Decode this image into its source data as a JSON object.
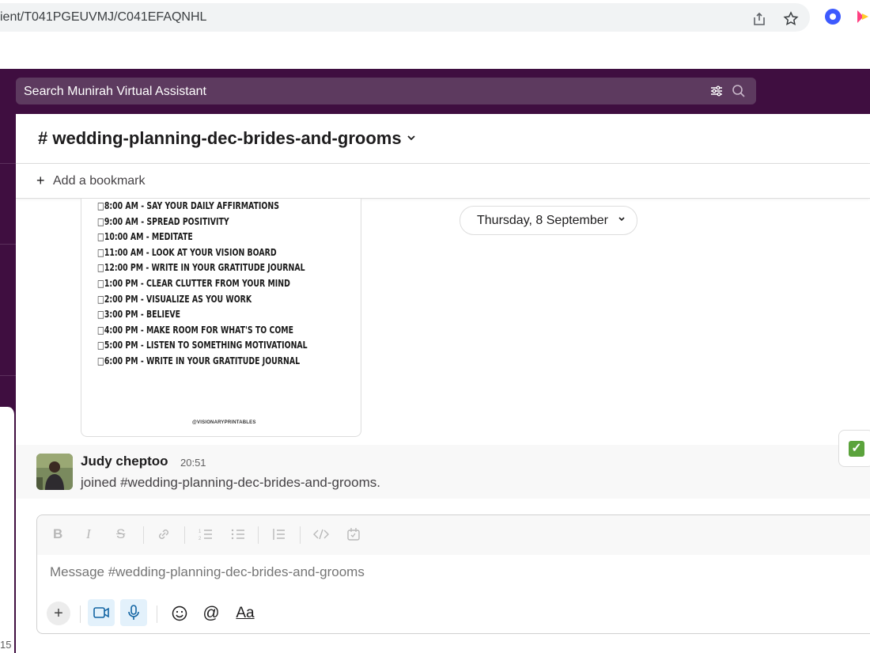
{
  "browser": {
    "url": "ient/T041PGEUVMJ/C041EFAQNHL"
  },
  "topbar": {
    "search_placeholder": "Search Munirah Virtual Assistant"
  },
  "sidebar": {
    "bottom_number": "15"
  },
  "channel": {
    "name": "# wedding-planning-dec-brides-and-grooms",
    "bookmark_label": "Add a bookmark"
  },
  "image_card": {
    "schedule": [
      "8:00 AM - SAY YOUR DAILY AFFIRMATIONS",
      "9:00 AM - SPREAD POSITIVITY",
      "10:00 AM - MEDITATE",
      "11:00 AM - LOOK AT YOUR VISION BOARD",
      "12:00 PM - WRITE IN YOUR GRATITUDE JOURNAL",
      "1:00 PM - CLEAR CLUTTER FROM YOUR MIND",
      "2:00 PM - VISUALIZE AS YOU WORK",
      "3:00 PM - BELIEVE",
      "4:00 PM - MAKE ROOM FOR WHAT'S TO COME",
      "5:00 PM - LISTEN TO SOMETHING MOTIVATIONAL",
      "6:00 PM - WRITE IN YOUR GRATITUDE JOURNAL"
    ],
    "watermark": "@VISIONARYPRINTABLES"
  },
  "date_divider": {
    "label": "Thursday, 8 September"
  },
  "message": {
    "author": "Judy cheptoo",
    "time": "20:51",
    "text": "joined #wedding-planning-dec-brides-and-grooms."
  },
  "composer": {
    "placeholder": "Message #wedding-planning-dec-brides-and-grooms",
    "text_format_label": "Aa"
  },
  "colors": {
    "aubergine": "#3f0e40",
    "search_bg": "#5d3a5f",
    "accent_blue": "#1264a3",
    "check_green": "#5ba33c"
  }
}
